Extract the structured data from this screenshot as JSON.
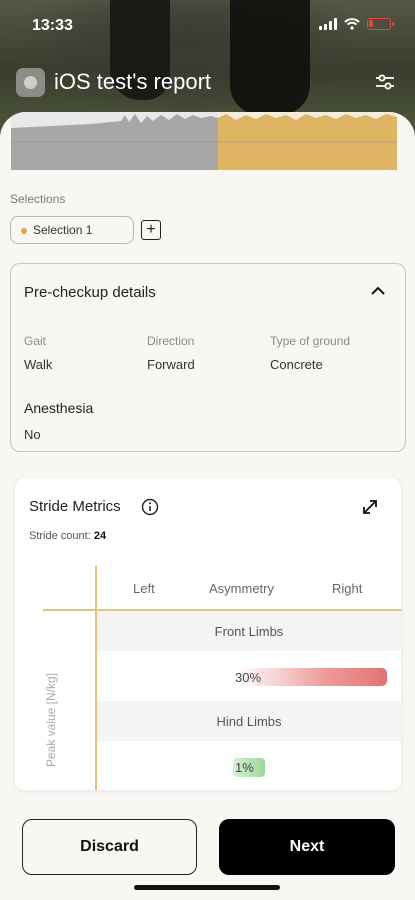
{
  "status_bar": {
    "time": "13:33"
  },
  "header": {
    "title": "iOS test's report"
  },
  "selections": {
    "label": "Selections",
    "items": [
      {
        "label": "Selection 1"
      }
    ],
    "add_label": "+"
  },
  "checkup": {
    "title": "Pre-checkup details",
    "fields": [
      {
        "label": "Gait",
        "value": "Walk"
      },
      {
        "label": "Direction",
        "value": "Forward"
      },
      {
        "label": "Type of ground",
        "value": "Concrete"
      }
    ],
    "anesthesia": {
      "label": "Anesthesia",
      "value": "No"
    }
  },
  "stride": {
    "title": "Stride Metrics",
    "count_label": "Stride count:",
    "count_value": "24",
    "columns": [
      "Left",
      "Asymmetry",
      "Right"
    ],
    "ylabel": "Peak value [N/kg]",
    "rows": [
      {
        "title": "Front Limbs",
        "asymmetry": "30%",
        "asymmetry_value": 30,
        "color": "#e67373"
      },
      {
        "title": "Hind Limbs",
        "asymmetry": "1%",
        "asymmetry_value": 1,
        "color": "#9bd89b"
      }
    ]
  },
  "actions": {
    "discard": "Discard",
    "next": "Next"
  },
  "colors": {
    "accent": "#e8a23a",
    "grid": "#e8c27a",
    "primary": "#000000"
  }
}
